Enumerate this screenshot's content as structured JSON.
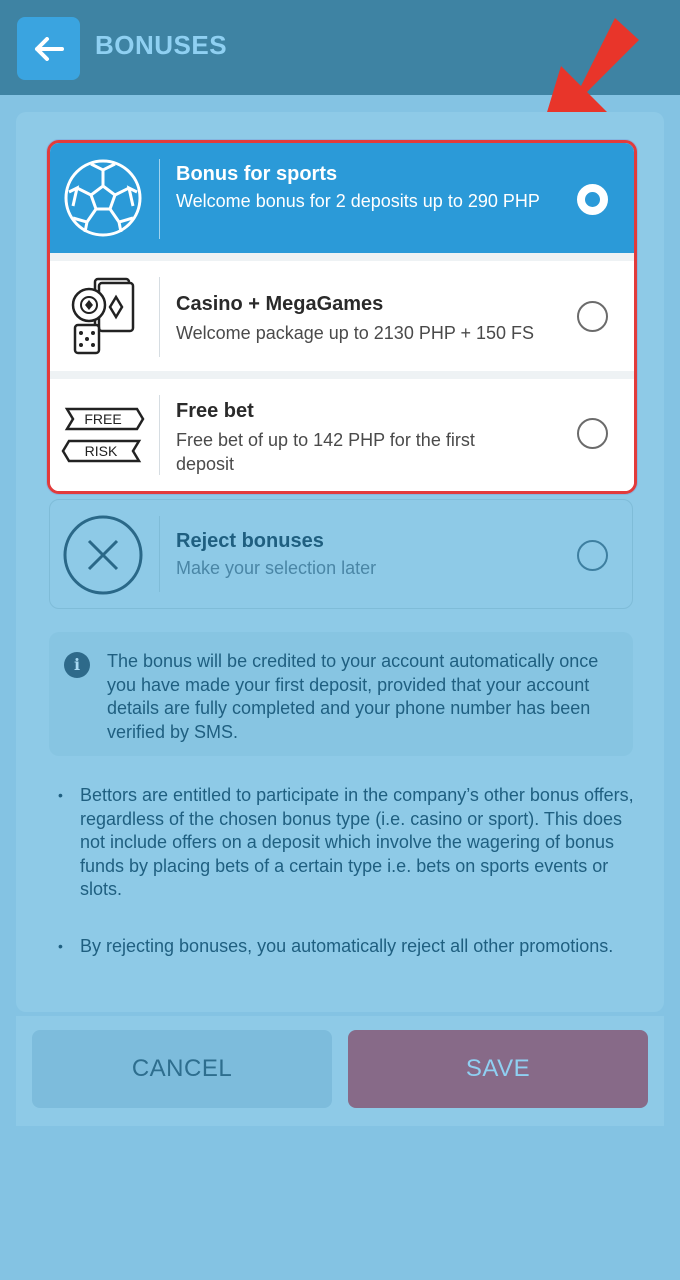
{
  "header": {
    "title": "BONUSES"
  },
  "options": [
    {
      "title": "Bonus for sports",
      "desc": "Welcome bonus for 2 deposits up to 290 PHP",
      "selected": true
    },
    {
      "title": "Casino + MegaGames",
      "desc": "Welcome package up to 2130 PHP + 150 FS",
      "selected": false
    },
    {
      "title": "Free bet",
      "desc": "Free bet of up to 142 PHP for the first deposit",
      "selected": false,
      "badge_top": "FREE",
      "badge_bottom": "RISK"
    }
  ],
  "reject": {
    "title": "Reject bonuses",
    "desc": "Make your selection later"
  },
  "info": {
    "icon": "i",
    "text": "The bonus will be credited to your account automatically once you have made your first deposit, provided that your account details are fully completed and your phone number has been verified by SMS."
  },
  "notes": [
    "Bettors are entitled to participate in the company’s other bonus offers, regardless of the chosen bonus type (i.e. casino or sport). This does not include offers on a deposit which involve the wagering of bonus funds by placing bets of a certain type i.e. bets on sports events or slots.",
    "By rejecting bonuses, you automatically reject all other promotions."
  ],
  "buttons": {
    "cancel": "CANCEL",
    "save": "SAVE"
  },
  "colors": {
    "header": "#3e83a3",
    "accent": "#2b9ad8",
    "highlight_border": "#e23b3b",
    "save": "#876a88"
  }
}
